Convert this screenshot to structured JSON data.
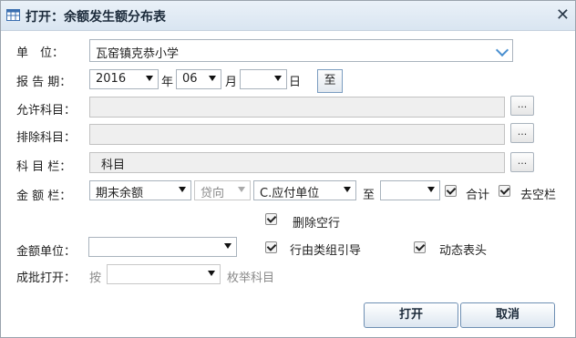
{
  "window": {
    "title": "打开：余额发生额分布表",
    "close_icon": "close-icon"
  },
  "labels": {
    "unit": "单　位：",
    "period": "报 告 期：",
    "allow_subject": "允许科目：",
    "exclude_subject": "排除科目：",
    "subject_column": "科 目 栏：",
    "amount_column": "金 额 栏：",
    "amount_unit": "金额单位：",
    "batch_open": "成批打开："
  },
  "unit": {
    "value": "瓦窑镇克恭小学"
  },
  "period": {
    "year": "2016",
    "year_suffix": "年",
    "month": "06",
    "month_suffix": "月",
    "day": "",
    "day_suffix": "日",
    "to_button": "至"
  },
  "allow_subject": {
    "value": "",
    "browse": "..."
  },
  "exclude_subject": {
    "value": "",
    "browse": "..."
  },
  "subject_column": {
    "value": "科目",
    "browse": "..."
  },
  "amount_column": {
    "balance_type": "期末余额",
    "direction": "贷向",
    "unit_item": "C.应付单位",
    "to_label": "至",
    "to_value": "",
    "total_label": "合计",
    "remove_empty_col_label": "去空栏"
  },
  "options": {
    "delete_empty_rows": "删除空行",
    "row_group_guide": "行由类组引导",
    "dynamic_header": "动态表头"
  },
  "amount_unit": {
    "value": ""
  },
  "batch_open": {
    "by_label": "按",
    "value": "",
    "suffix": "枚举科目"
  },
  "buttons": {
    "open": "打开",
    "cancel": "取消"
  }
}
